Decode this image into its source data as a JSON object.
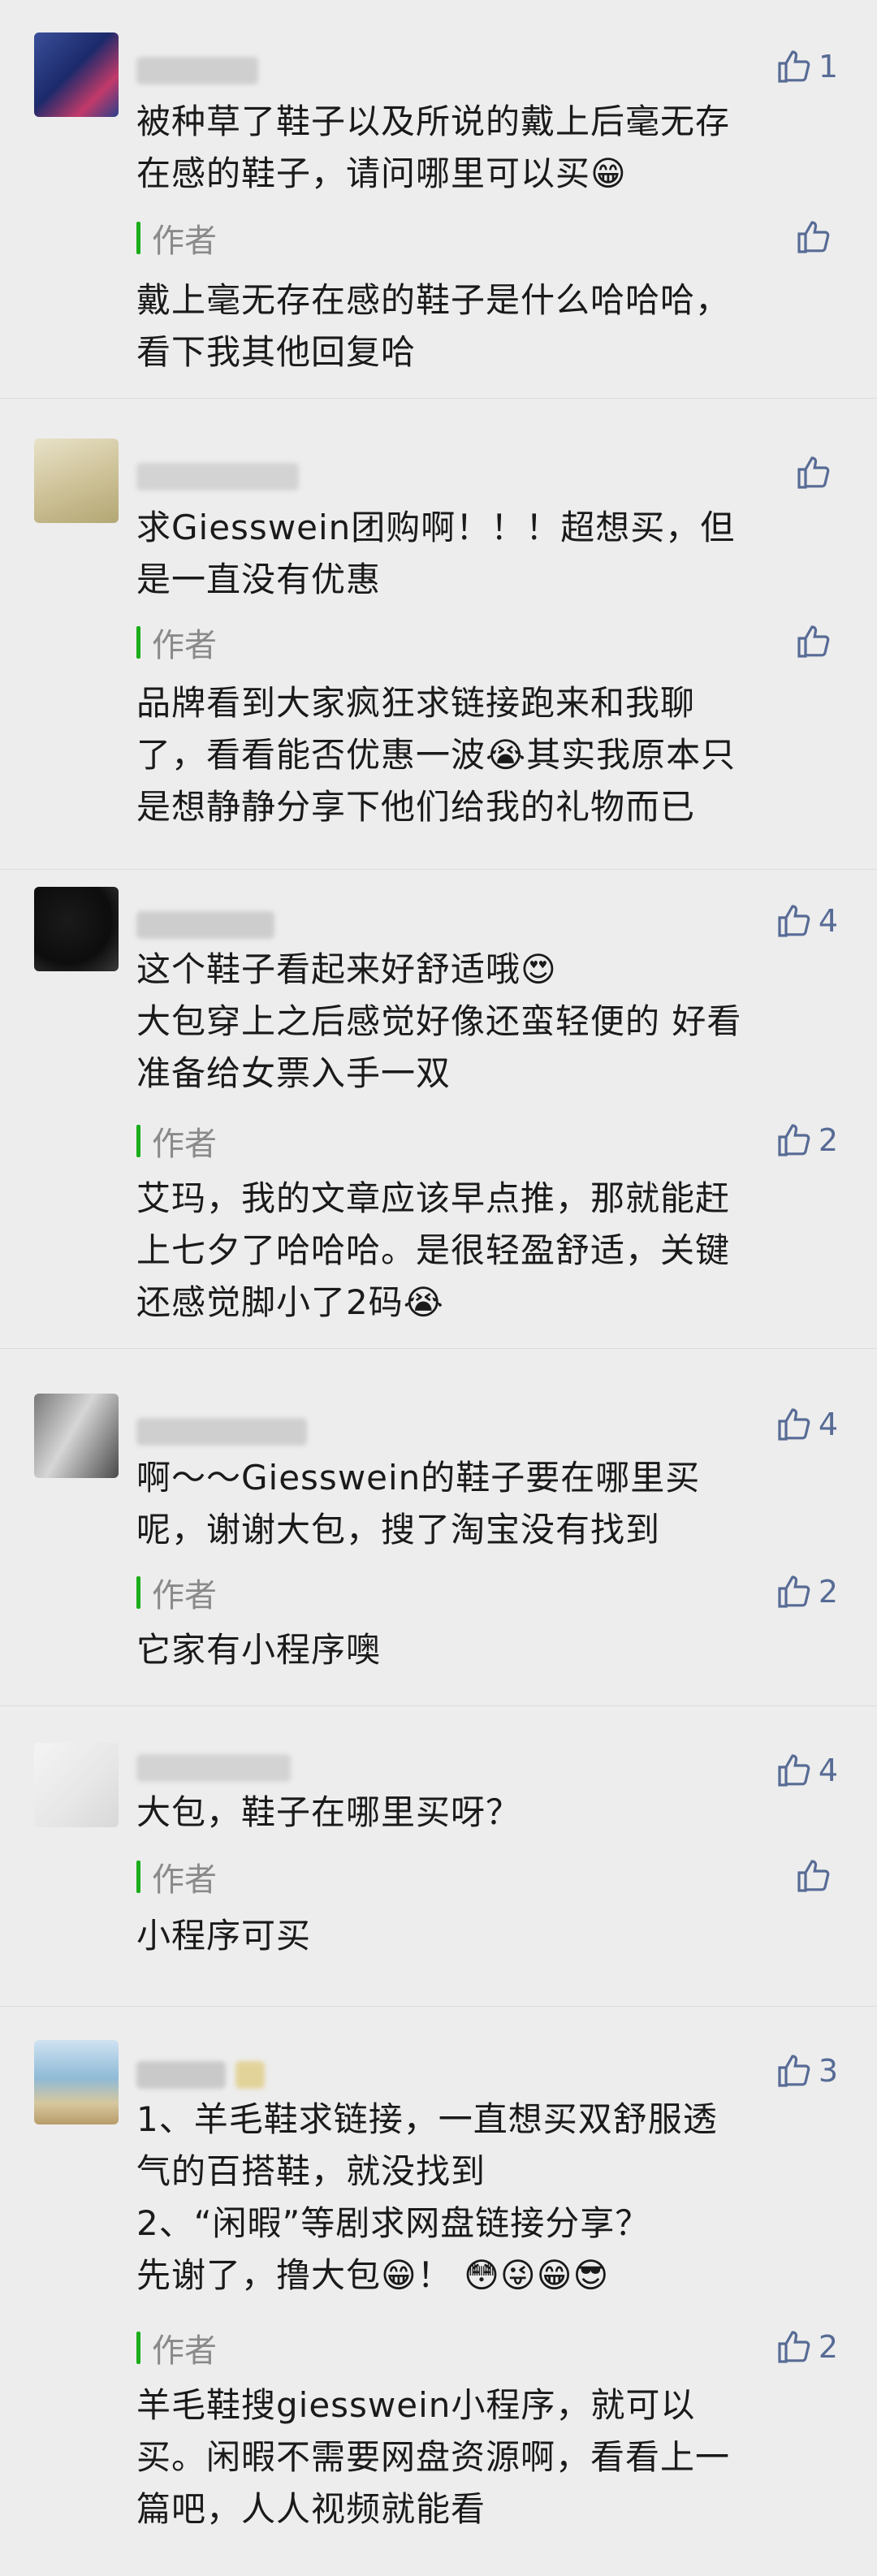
{
  "colors": {
    "link": "#576b95",
    "author_bar": "#1aad19",
    "background": "#ededed"
  },
  "comments": [
    {
      "like_count": "1",
      "text": "被种草了鞋子以及所说的戴上后毫无存\n在感的鞋子，请问哪里可以买😁",
      "reply": {
        "label": "作者",
        "like_count": "",
        "text": "戴上毫无存在感的鞋子是什么哈哈哈，\n看下我其他回复哈"
      }
    },
    {
      "like_count": "",
      "text": "求Giesswein团购啊！！！超想买，但\n是一直没有优惠",
      "reply": {
        "label": "作者",
        "like_count": "",
        "text": "品牌看到大家疯狂求链接跑来和我聊\n了，看看能否优惠一波😭其实我原本只\n是想静静分享下他们给我的礼物而已"
      }
    },
    {
      "like_count": "4",
      "text": "这个鞋子看起来好舒适哦😍\n大包穿上之后感觉好像还蛮轻便的 好看\n准备给女票入手一双",
      "reply": {
        "label": "作者",
        "like_count": "2",
        "text": "艾玛，我的文章应该早点推，那就能赶\n上七夕了哈哈哈。是很轻盈舒适，关键\n还感觉脚小了2码😭"
      }
    },
    {
      "like_count": "4",
      "text": "啊～～Giesswein的鞋子要在哪里买\n呢，谢谢大包，搜了淘宝没有找到",
      "reply": {
        "label": "作者",
        "like_count": "2",
        "text": "它家有小程序噢"
      }
    },
    {
      "like_count": "4",
      "text": "大包，鞋子在哪里买呀？",
      "reply": {
        "label": "作者",
        "like_count": "",
        "text": "小程序可买"
      }
    },
    {
      "like_count": "3",
      "text": "1、羊毛鞋求链接，一直想买双舒服透\n气的百搭鞋，就没找到\n2、“闲暇”等剧求网盘链接分享？\n先谢了，撸大包😁！ 😳😜😁😎",
      "reply": {
        "label": "作者",
        "like_count": "2",
        "text": "羊毛鞋搜giesswein小程序，就可以\n买。闲暇不需要网盘资源啊，看看上一\n篇吧，人人视频就能看"
      }
    }
  ]
}
